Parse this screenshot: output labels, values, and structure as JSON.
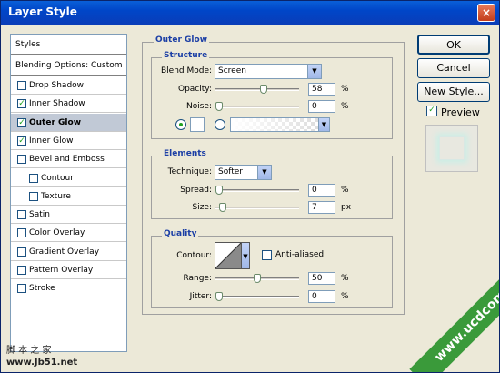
{
  "window": {
    "title": "Layer Style",
    "close_icon": "×"
  },
  "styles_panel": {
    "header": "Styles",
    "blending": "Blending Options: Custom",
    "items": [
      {
        "label": "Drop Shadow",
        "checked": false,
        "indent": false,
        "selected": false
      },
      {
        "label": "Inner Shadow",
        "checked": true,
        "indent": false,
        "selected": false
      },
      {
        "label": "Outer Glow",
        "checked": true,
        "indent": false,
        "selected": true
      },
      {
        "label": "Inner Glow",
        "checked": true,
        "indent": false,
        "selected": false
      },
      {
        "label": "Bevel and Emboss",
        "checked": false,
        "indent": false,
        "selected": false
      },
      {
        "label": "Contour",
        "checked": false,
        "indent": true,
        "selected": false
      },
      {
        "label": "Texture",
        "checked": false,
        "indent": true,
        "selected": false
      },
      {
        "label": "Satin",
        "checked": false,
        "indent": false,
        "selected": false
      },
      {
        "label": "Color Overlay",
        "checked": false,
        "indent": false,
        "selected": false
      },
      {
        "label": "Gradient Overlay",
        "checked": false,
        "indent": false,
        "selected": false
      },
      {
        "label": "Pattern Overlay",
        "checked": false,
        "indent": false,
        "selected": false
      },
      {
        "label": "Stroke",
        "checked": false,
        "indent": false,
        "selected": false
      }
    ]
  },
  "outer_glow": {
    "title": "Outer Glow",
    "structure": {
      "title": "Structure",
      "blend_mode_label": "Blend Mode:",
      "blend_mode_value": "Screen",
      "opacity_label": "Opacity:",
      "opacity_value": "58",
      "opacity_unit": "%",
      "noise_label": "Noise:",
      "noise_value": "0",
      "noise_unit": "%"
    },
    "elements": {
      "title": "Elements",
      "technique_label": "Technique:",
      "technique_value": "Softer",
      "spread_label": "Spread:",
      "spread_value": "0",
      "spread_unit": "%",
      "size_label": "Size:",
      "size_value": "7",
      "size_unit": "px"
    },
    "quality": {
      "title": "Quality",
      "contour_label": "Contour:",
      "anti_aliased_label": "Anti-aliased",
      "anti_aliased_checked": false,
      "range_label": "Range:",
      "range_value": "50",
      "range_unit": "%",
      "jitter_label": "Jitter:",
      "jitter_value": "0",
      "jitter_unit": "%"
    }
  },
  "buttons": {
    "ok": "OK",
    "cancel": "Cancel",
    "new_style": "New Style...",
    "preview_label": "Preview",
    "preview_checked": true
  },
  "watermarks": {
    "site_cn": "脚 本 之 家",
    "site_url": "www.Jb51.net",
    "banner": "www.ucdcom.com"
  },
  "colors": {
    "title_bar": "#0a46c8",
    "group_title": "#1c3fa5",
    "selected_row": "#c1c9d6",
    "preview_glow": "#bff0e8"
  }
}
